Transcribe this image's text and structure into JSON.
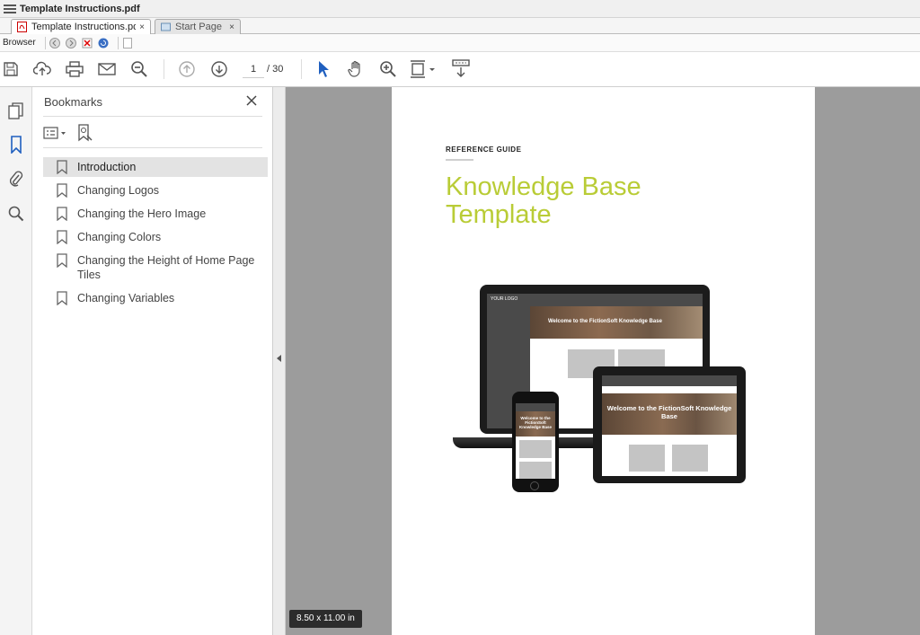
{
  "window": {
    "title": "Template Instructions.pdf"
  },
  "tabs": [
    {
      "label": "Template Instructions.pdf",
      "close": "×",
      "active": true
    },
    {
      "label": "Start Page",
      "close": "×",
      "active": false
    }
  ],
  "browser_bar": {
    "label": "Browser"
  },
  "toolbar": {
    "page_current": "1",
    "page_total": "/ 30"
  },
  "bookmarks": {
    "title": "Bookmarks",
    "close": "✕",
    "items": [
      {
        "label": "Introduction",
        "selected": true
      },
      {
        "label": "Changing Logos"
      },
      {
        "label": "Changing the Hero Image"
      },
      {
        "label": "Changing Colors"
      },
      {
        "label": "Changing the Height of Home Page Tiles"
      },
      {
        "label": "Changing Variables"
      }
    ]
  },
  "document": {
    "kicker": "REFERENCE GUIDE",
    "title": "Knowledge Base Template",
    "title_color": "#b9cc36",
    "page_size": "8.50 x 11.00 in",
    "mockup": {
      "logo_text": "YOUR LOGO",
      "hero_text": "Welcome to the FictionSoft Knowledge Base",
      "phone_hero_text": "Welcome to the FictionSoft Knowledge Base"
    }
  }
}
